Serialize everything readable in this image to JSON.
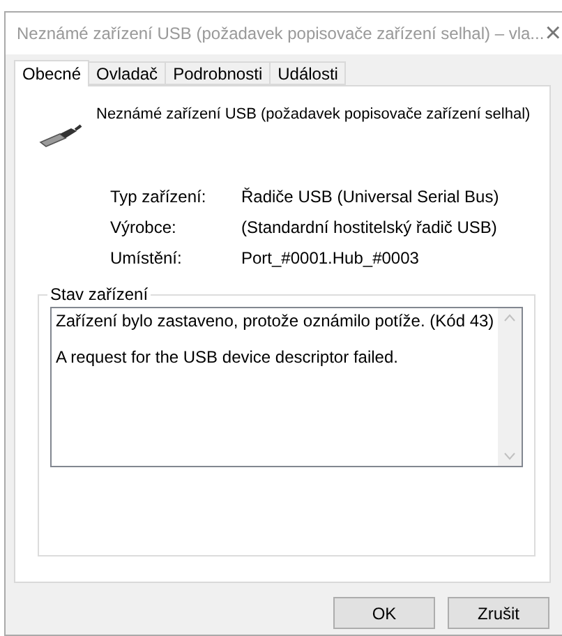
{
  "window": {
    "title": "Neznámé zařízení USB (požadavek popisovače zařízení selhal) – vla...",
    "close": "×"
  },
  "tabs": [
    {
      "label": "Obecné",
      "selected": true
    },
    {
      "label": "Ovladač",
      "selected": false
    },
    {
      "label": "Podrobnosti",
      "selected": false
    },
    {
      "label": "Události",
      "selected": false
    }
  ],
  "device": {
    "name": "Neznámé zařízení USB (požadavek popisovače zařízení selhal)"
  },
  "properties": [
    {
      "label": "Typ zařízení:",
      "value": "Řadiče USB (Universal Serial Bus)"
    },
    {
      "label": "Výrobce:",
      "value": "(Standardní hostitelský řadič USB)"
    },
    {
      "label": "Umístění:",
      "value": "Port_#0001.Hub_#0003"
    }
  ],
  "status": {
    "title": "Stav zařízení",
    "lines": [
      "Zařízení bylo zastaveno, protože oznámilo potíže. (Kód 43)",
      "A request for the USB device descriptor failed."
    ]
  },
  "buttons": [
    "OK",
    "Zrušit"
  ]
}
